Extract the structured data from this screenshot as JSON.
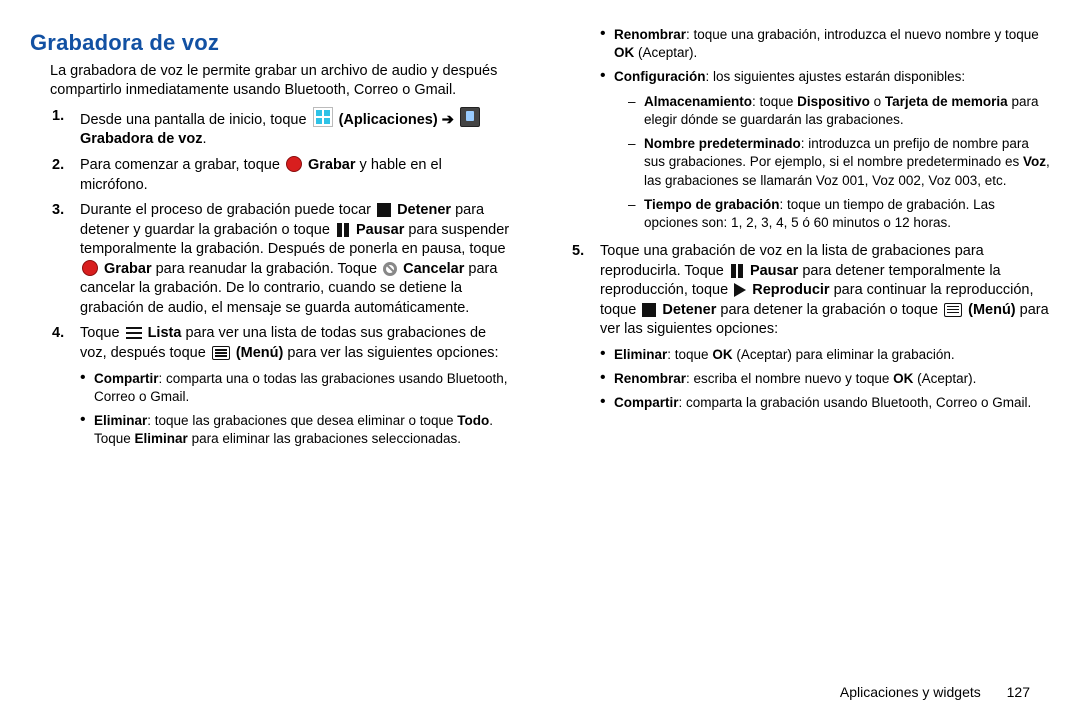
{
  "title": "Grabadora de voz",
  "intro": "La grabadora de voz le permite grabar un archivo de audio y después compartirlo inmediatamente usando Bluetooth, Correo o Gmail.",
  "s1a": "Desde una pantalla de inicio, toque ",
  "s1apps": "(Aplicaciones)",
  "arrow": "➔",
  "s1rec": "Grabadora de voz",
  "s2a": "Para comenzar a grabar, toque ",
  "s2b": "Grabar",
  "s2c": " y hable en el micrófono.",
  "s3a": "Durante el proceso de grabación puede tocar ",
  "s3stop": "Detener",
  "s3b": " para detener y guardar la grabación o toque ",
  "s3pause": "Pausar",
  "s3c": " para suspender temporalmente la grabación. Después de ponerla en pausa, toque ",
  "s3rec": "Grabar",
  "s3d": " para reanudar la grabación. Toque ",
  "s3cancel": "Cancelar",
  "s3e": " para cancelar la grabación. De lo contrario, cuando se detiene la grabación de audio, el mensaje se guarda automáticamente.",
  "s4a": "Toque ",
  "s4list": "Lista",
  "s4b": " para ver una lista de todas sus grabaciones de voz, después toque ",
  "s4menu": "(Menú)",
  "s4c": " para ver las siguientes opciones:",
  "s4_share_label": "Compartir",
  "s4_share_text": ": comparta una o todas las grabaciones usando Bluetooth, Correo o Gmail.",
  "s4_del_label": "Eliminar",
  "s4_del_text1": ": toque las grabaciones que desea eliminar o toque ",
  "s4_del_todo": "Todo",
  "s4_del_text2": ". Toque ",
  "s4_del_elim": "Eliminar",
  "s4_del_text3": " para eliminar las grabaciones seleccionadas.",
  "s4_ren_label": "Renombrar",
  "s4_ren_text1": ": toque una grabación, introduzca el nuevo nombre y toque ",
  "s4_ren_ok": "OK",
  "s4_ren_text2": " (Aceptar).",
  "s4_cfg_label": "Configuración",
  "s4_cfg_text": ": los siguientes ajustes estarán disponibles:",
  "cfg_store_label": "Almacenamiento",
  "cfg_store_text1": ": toque ",
  "cfg_store_dev": "Dispositivo",
  "cfg_store_o": " o ",
  "cfg_store_card": "Tarjeta de memoria",
  "cfg_store_text2": " para elegir dónde se guardarán las grabaciones.",
  "cfg_name_label": "Nombre predeterminado",
  "cfg_name_text1": ": introduzca un prefijo de nombre para sus grabaciones. Por ejemplo, si el nombre predeterminado es ",
  "cfg_name_voz": "Voz",
  "cfg_name_text2": ", las grabaciones se llamarán Voz 001, Voz 002, Voz 003, etc.",
  "cfg_time_label": "Tiempo de grabación",
  "cfg_time_text": ": toque un tiempo de grabación. Las opciones son: 1, 2, 3, 4, 5 ó 60 minutos o 12 horas.",
  "s5a": "Toque una grabación de voz en la lista de grabaciones para reproducirla. Toque ",
  "s5pauselbl": "Pausar",
  "s5b": " para detener temporalmente la reproducción, toque ",
  "s5playlbl": "Reproducir",
  "s5c": " para continuar la reproducción, toque ",
  "s5stoplbl": "Detener",
  "s5d": " para detener la grabación o toque ",
  "s5menulbl": "(Menú)",
  "s5e": " para ver las siguientes opciones:",
  "s5_del_label": "Eliminar",
  "s5_del_text1": ": toque ",
  "s5_del_ok": "OK",
  "s5_del_text2": " (Aceptar) para eliminar la grabación.",
  "s5_ren_label": "Renombrar",
  "s5_ren_text1": ": escriba el nombre nuevo y toque ",
  "s5_ren_ok": "OK",
  "s5_ren_text2": " (Aceptar).",
  "s5_share_label": "Compartir",
  "s5_share_text": ": comparta la grabación usando Bluetooth, Correo o Gmail.",
  "footer_section": "Aplicaciones y widgets",
  "footer_page": "127"
}
